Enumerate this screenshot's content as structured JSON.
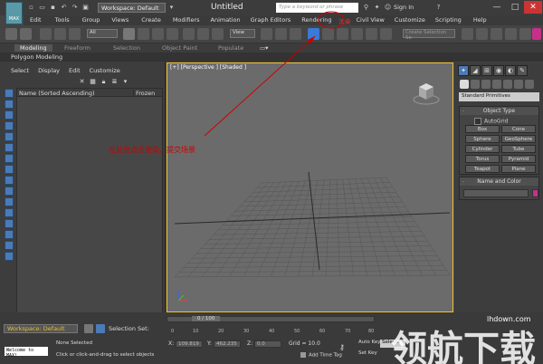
{
  "window": {
    "app_logo": "MAX",
    "workspace": "Workspace: Default",
    "title": "Untitled",
    "search_placeholder": "Type a keyword or phrase",
    "sign_in": "Sign In",
    "help_icon": "?",
    "minimize": "—",
    "maximize": "□",
    "close": "✕"
  },
  "menu": [
    "Edit",
    "Tools",
    "Group",
    "Views",
    "Create",
    "Modifiers",
    "Animation",
    "Graph Editors",
    "Rendering",
    "渲染",
    "Civil View",
    "Customize",
    "Scripting",
    "Help"
  ],
  "toolbar": {
    "filter": "All",
    "view": "View",
    "selection_set_placeholder": "Create Selection Se"
  },
  "ribbon": {
    "tabs": [
      "Modeling",
      "Freeform",
      "Selection",
      "Object Paint",
      "Populate"
    ],
    "sub": "Polygon Modeling"
  },
  "scene_explorer": {
    "menu": [
      "Select",
      "Display",
      "Edit",
      "Customize"
    ],
    "col_name": "Name (Sorted Ascending)",
    "col_frozen": "Frozen"
  },
  "viewport": {
    "label": "[+] [Perspective ] [Shaded ]",
    "annotation": "在此处点击渲染，提交场景"
  },
  "command_panel": {
    "category": "Standard Primitives",
    "object_type_title": "Object Type",
    "autogrid": "AutoGrid",
    "objects": [
      "Box",
      "Cone",
      "Sphere",
      "GeoSphere",
      "Cylinder",
      "Tube",
      "Torus",
      "Pyramid",
      "Teapot",
      "Plane"
    ],
    "name_color_title": "Name and Color",
    "object_color": "#c6308a"
  },
  "bottom": {
    "workspace": "Workspace: Default",
    "selection_set": "Selection Set:",
    "time": "0 / 100",
    "ticks": [
      "0",
      "10",
      "20",
      "30",
      "40",
      "50",
      "60",
      "70",
      "80"
    ],
    "maxscript": "Welcome to MAX!",
    "status_selected": "None Selected",
    "status_prompt": "Click or click-and-drag to select objects",
    "x_label": "X:",
    "x_value": "109.819",
    "y_label": "Y:",
    "y_value": "462.235",
    "z_label": "Z:",
    "z_value": "0.0",
    "grid": "Grid = 10.0",
    "add_time_tag": "Add Time Tag",
    "auto_key": "Auto Key",
    "set_key": "Set Key",
    "selected": "Selecte"
  },
  "watermark": {
    "big": "领航下载",
    "small": "lhdown.com"
  },
  "colors": {
    "accent": "#4a7ab8",
    "viewport_border": "#f0c030",
    "annotation": "#cc0000"
  }
}
